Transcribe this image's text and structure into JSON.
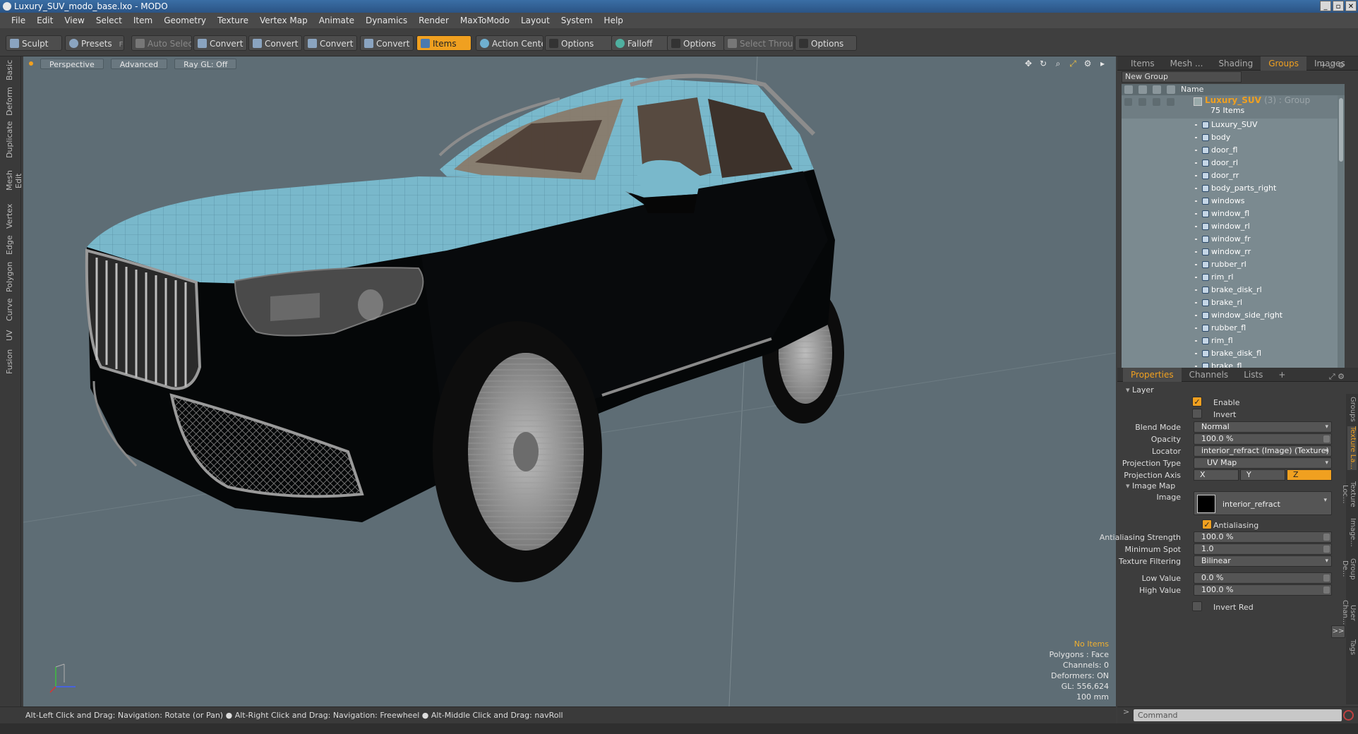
{
  "window": {
    "title": "Luxury_SUV_modo_base.lxo - MODO",
    "controls": [
      "_",
      "▫",
      "✕"
    ]
  },
  "menu": [
    "File",
    "Edit",
    "View",
    "Select",
    "Item",
    "Geometry",
    "Texture",
    "Vertex Map",
    "Animate",
    "Dynamics",
    "Render",
    "MaxToModo",
    "Layout",
    "System",
    "Help"
  ],
  "toolbar": {
    "sculpt": "Sculpt",
    "presets": "Presets",
    "presets_key": "F6",
    "auto_select": "Auto Select",
    "convert": "Convert",
    "items": "Items",
    "action_center": "Action Center",
    "options": "Options",
    "falloff": "Falloff",
    "select_through": "Select Through"
  },
  "left_tabs": [
    "Basic",
    "Deform",
    "Duplicate",
    "Mesh Edit",
    "Vertex",
    "Edge",
    "Polygon",
    "Curve",
    "UV",
    "Fusion"
  ],
  "viewport": {
    "view": "Perspective",
    "shading": "Advanced",
    "raygl": "Ray GL: Off",
    "info": {
      "noitems": "No Items",
      "polygons": "Polygons : Face",
      "channels": "Channels: 0",
      "deformers": "Deformers: ON",
      "gl": "GL: 556,624",
      "scale": "100 mm"
    },
    "colors": {
      "bg": "#5e6d75",
      "body": "#050708",
      "highlight": "#79b8cb"
    }
  },
  "status": "Alt-Left Click and Drag: Navigation: Rotate (or Pan) ● Alt-Right Click and Drag: Navigation: Freewheel ● Alt-Middle Click and Drag: navRoll",
  "command": {
    "placeholder": "Command"
  },
  "groups_panel": {
    "tabs": [
      "Items",
      "Mesh ...",
      "Shading",
      "Groups",
      "Images"
    ],
    "active_tab": "Groups",
    "new_group": "New Group",
    "col_name": "Name",
    "root": {
      "name": "Luxury_SUV",
      "suffix": "(3) : Group",
      "count": "75 Items"
    },
    "items": [
      "Luxury_SUV",
      "body",
      "door_fl",
      "door_rl",
      "door_rr",
      "body_parts_right",
      "windows",
      "window_fl",
      "window_rl",
      "window_fr",
      "window_rr",
      "rubber_rl",
      "rim_rl",
      "brake_disk_rl",
      "brake_rl",
      "window_side_right",
      "rubber_fl",
      "rim_fl",
      "brake_disk_fl",
      "brake_fl"
    ]
  },
  "props_panel": {
    "tabs": [
      "Properties",
      "Channels",
      "Lists"
    ],
    "section_layer": "Layer",
    "enable": "Enable",
    "invert": "Invert",
    "blend_mode_label": "Blend Mode",
    "blend_mode": "Normal",
    "opacity_label": "Opacity",
    "opacity": "100.0 %",
    "locator_label": "Locator",
    "locator": "interior_refract (Image) (Texture)",
    "proj_type_label": "Projection Type",
    "proj_type": "UV Map",
    "proj_axis_label": "Projection Axis",
    "axis_x": "X",
    "axis_y": "Y",
    "axis_z": "Z",
    "section_imagemap": "Image Map",
    "image_label": "Image",
    "image": "interior_refract",
    "antialiasing": "Antialiasing",
    "aa_strength_label": "Antialiasing Strength",
    "aa_strength": "100.0 %",
    "min_spot_label": "Minimum Spot",
    "min_spot": "1.0",
    "tex_filter_label": "Texture Filtering",
    "tex_filter": "Bilinear",
    "low_label": "Low Value",
    "low": "0.0 %",
    "high_label": "High Value",
    "high": "100.0 %",
    "invert_red": "Invert Red",
    "more": ">>",
    "side_tabs": [
      "Groups",
      "Texture La...",
      "Texture Loc...",
      "Image...",
      "Group De...",
      "User Chan...",
      "Tags"
    ]
  }
}
